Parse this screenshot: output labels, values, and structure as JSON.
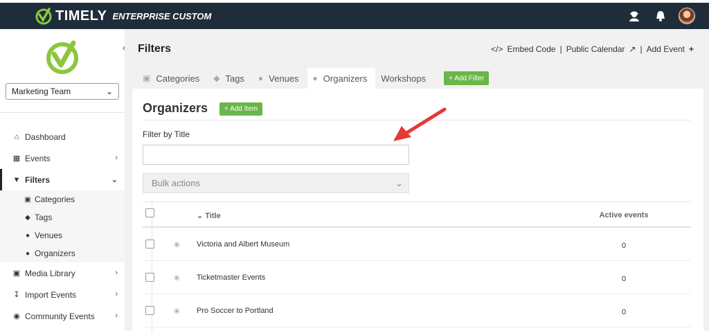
{
  "brand": {
    "name": "TIMELY",
    "edition": "ENTERPRISE CUSTOM"
  },
  "topbar": {
    "icons": [
      "user-support-icon",
      "bell-icon",
      "avatar"
    ]
  },
  "sidebar": {
    "account_select": "Marketing Team",
    "items": [
      {
        "label": "Dashboard",
        "icon": "home-icon"
      },
      {
        "label": "Events",
        "icon": "calendar-icon"
      },
      {
        "label": "Filters",
        "icon": "filter-icon"
      },
      {
        "label": "Media Library",
        "icon": "image-icon"
      },
      {
        "label": "Import Events",
        "icon": "download-icon"
      },
      {
        "label": "Community Events",
        "icon": "globe-icon"
      }
    ],
    "filters_sub": [
      {
        "label": "Categories",
        "icon": "sitemap-icon"
      },
      {
        "label": "Tags",
        "icon": "tag-icon"
      },
      {
        "label": "Venues",
        "icon": "map-pin-icon"
      },
      {
        "label": "Organizers",
        "icon": "users-icon"
      }
    ]
  },
  "header": {
    "title": "Filters",
    "embed_code": "Embed Code",
    "public_calendar": "Public Calendar",
    "add_event": "Add Event",
    "sep": "|"
  },
  "tabs": [
    {
      "label": "Categories"
    },
    {
      "label": "Tags"
    },
    {
      "label": "Venues"
    },
    {
      "label": "Organizers"
    },
    {
      "label": "Workshops"
    }
  ],
  "add_filter_label": "+ Add Filter",
  "panel": {
    "title": "Organizers",
    "add_item_label": "+ Add Item",
    "filter_label": "Filter by Title",
    "bulk_actions": "Bulk actions",
    "col_title": "Title",
    "col_active": "Active events",
    "rows": [
      {
        "title": "Victoria and Albert Museum",
        "active": "0"
      },
      {
        "title": "Ticketmaster Events",
        "active": "0"
      },
      {
        "title": "Pro Soccer to Portland",
        "active": "0"
      }
    ]
  },
  "colors": {
    "topbar": "#1f2d3a",
    "accent": "#6ab648",
    "arrow": "#e53935"
  }
}
